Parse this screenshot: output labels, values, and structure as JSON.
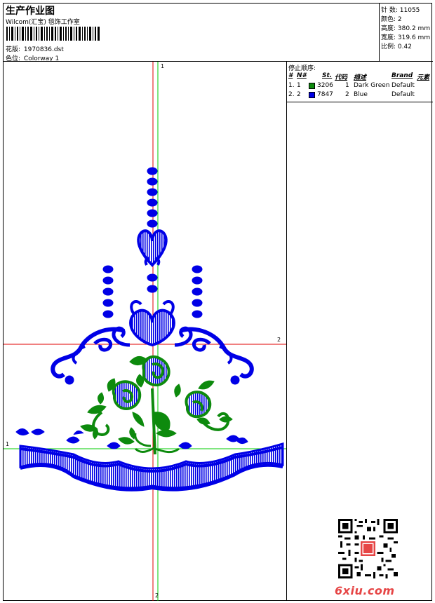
{
  "header": {
    "title": "生产作业图",
    "company": "Wilcom(汇宝) 毯饰工作室",
    "file_label": "花版:",
    "file_value": "1970836.dst",
    "colorway_label": "色位:",
    "colorway_value": "Colorway 1"
  },
  "stats": {
    "stitches_label": "针 数:",
    "stitches_value": "11055",
    "colors_label": "颜色:",
    "colors_value": "2",
    "height_label": "高度:",
    "height_value": "380.2 mm",
    "width_label": "宽度:",
    "width_value": "319.6 mm",
    "scale_label": "比例:",
    "scale_value": "0.42"
  },
  "legend": {
    "title": "停止顺序:",
    "headers": {
      "idx": "#",
      "num": "N#",
      "st": "St.",
      "code": "代码",
      "desc": "描述",
      "brand": "Brand",
      "element": "元素"
    },
    "rows": [
      {
        "idx": "1.",
        "num": "1",
        "color": "#0d8a0d",
        "st": "3206",
        "code": "1",
        "desc": "Dark Green",
        "brand": "Default"
      },
      {
        "idx": "2.",
        "num": "2",
        "color": "#0000e6",
        "st": "7847",
        "code": "2",
        "desc": "Blue",
        "brand": "Default"
      }
    ]
  },
  "axes": {
    "top": "1",
    "bottom": "2",
    "left": "1",
    "right": "2"
  },
  "colors": {
    "thread_blue": "#0000e6",
    "thread_green": "#0d8a0d",
    "axis_red": "#e00000",
    "axis_green": "#00cc00"
  },
  "watermark": {
    "site": "6xiu.com",
    "qr_icon": "qr-code-icon",
    "seal_icon": "seal-icon"
  }
}
